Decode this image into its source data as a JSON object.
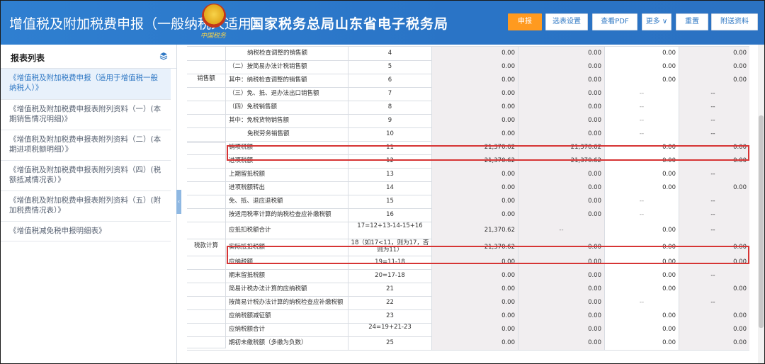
{
  "header": {
    "title": "增值税及附加税费申报（一般纳税人适用）",
    "emblem_text": "中国税务",
    "bureau": "国家税务总局山东省电子税务局",
    "buttons": {
      "declare": "申报",
      "select_settings": "选表设置",
      "view_pdf": "查看PDF",
      "more": "更多",
      "reset": "重置",
      "attach": "附送资料"
    }
  },
  "sidebar": {
    "title": "报表列表",
    "items": [
      {
        "label": "《增值税及附加税费申报（适用于增值税一般纳税人）》"
      },
      {
        "label": "《增值税及附加税费申报表附列资料（一）(本期销售情况明细)》"
      },
      {
        "label": "《增值税及附加税费申报表附列资料（二）(本期进项税额明细）》"
      },
      {
        "label": "《增值税及附加税费申报表附列资料（四）(税额抵减情况表）》"
      },
      {
        "label": "《增值税及附加税费申报表附列资料（五）(附加税费情况表）》"
      },
      {
        "label": "《增值税减免税申报明细表》"
      }
    ]
  },
  "table": {
    "categories": {
      "sales": "销售额",
      "tax_calc": "税款计算"
    },
    "rows": [
      {
        "name": "纳税检查调整的销售额",
        "line": "4",
        "v1": "0.00",
        "v2": "0.00",
        "v3": "0.00",
        "v4": "0.00"
      },
      {
        "name": "（二）按简易办法计税销售额",
        "line": "5",
        "v1": "0.00",
        "v2": "0.00",
        "v3": "0.00",
        "v4": "0.00"
      },
      {
        "name": "其中：纳税检查调整的销售额",
        "line": "6",
        "v1": "0.00",
        "v2": "0.00",
        "v3": "0.00",
        "v4": "0.00"
      },
      {
        "name": "（三）免、抵、退办法出口销售额",
        "line": "7",
        "v1": "0.00",
        "v2": "0.00",
        "v3": "--",
        "v4": "--"
      },
      {
        "name": "（四）免税销售额",
        "line": "8",
        "v1": "0.00",
        "v2": "0.00",
        "v3": "--",
        "v4": "--"
      },
      {
        "name": "其中：免税货物销售额",
        "line": "9",
        "v1": "0.00",
        "v2": "0.00",
        "v3": "--",
        "v4": "--"
      },
      {
        "name": "免税劳务销售额",
        "line": "10",
        "v1": "0.00",
        "v2": "0.00",
        "v3": "--",
        "v4": "--"
      },
      {
        "name": "销项税额",
        "line": "11",
        "v1": "21,370.62",
        "v2": "21,370.62",
        "v3": "0.00",
        "v4": "0.00"
      },
      {
        "name": "进项税额",
        "line": "12",
        "v1": "21,370.62",
        "v2": "21,370.62",
        "v3": "0.00",
        "v4": "0.00"
      },
      {
        "name": "上期留抵税额",
        "line": "13",
        "v1": "0.00",
        "v2": "0.00",
        "v3": "0.00",
        "v4": "--"
      },
      {
        "name": "进项税额转出",
        "line": "14",
        "v1": "0.00",
        "v2": "0.00",
        "v3": "0.00",
        "v4": "0.00"
      },
      {
        "name": "免、抵、退应退税额",
        "line": "15",
        "v1": "0.00",
        "v2": "0.00",
        "v3": "--",
        "v4": "--"
      },
      {
        "name": "按适用税率计算的纳税检查应补缴税额",
        "line": "16",
        "v1": "0.00",
        "v2": "0.00",
        "v3": "--",
        "v4": "--"
      },
      {
        "name": "应抵扣税额合计",
        "line": "17=12+13-14-15+16",
        "v1": "21,370.62",
        "v2": "--",
        "v3": "0.00",
        "v4": "--"
      },
      {
        "name": "实际抵扣税额",
        "line": "18（如17<11，则为17，否则为11）",
        "v1": "21,370.62",
        "v2": "0.00",
        "v3": "0.00",
        "v4": "0.00"
      },
      {
        "name": "应纳税额",
        "line": "19=11-18",
        "v1": "0.00",
        "v2": "0.00",
        "v3": "0.00",
        "v4": "0.00"
      },
      {
        "name": "期末留抵税额",
        "line": "20=17-18",
        "v1": "0.00",
        "v2": "0.00",
        "v3": "0.00",
        "v4": "--"
      },
      {
        "name": "简易计税办法计算的应纳税额",
        "line": "21",
        "v1": "0.00",
        "v2": "0.00",
        "v3": "0.00",
        "v4": "0.00"
      },
      {
        "name": "按简易计税办法计算的纳税检查应补缴税额",
        "line": "22",
        "v1": "0.00",
        "v2": "0.00",
        "v3": "--",
        "v4": "--"
      },
      {
        "name": "应纳税额减征额",
        "line": "23",
        "v1": "0.00",
        "v2": "0.00",
        "v3": "0.00",
        "v4": "0.00"
      },
      {
        "name": "应纳税额合计",
        "line": "24=19+21-23",
        "v1": "0.00",
        "v2": "0.00",
        "v3": "0.00",
        "v4": "0.00"
      },
      {
        "name": "期初未缴税额（多缴为负数）",
        "line": "25",
        "v1": "0.00",
        "v2": "0.00",
        "v3": "0.00",
        "v4": "0.00"
      }
    ]
  },
  "colors": {
    "header_blue": "#2f7fd0",
    "primary_orange": "#ff9a1f",
    "highlight_red": "#d63434",
    "readonly_cell": "#f1eef0"
  }
}
